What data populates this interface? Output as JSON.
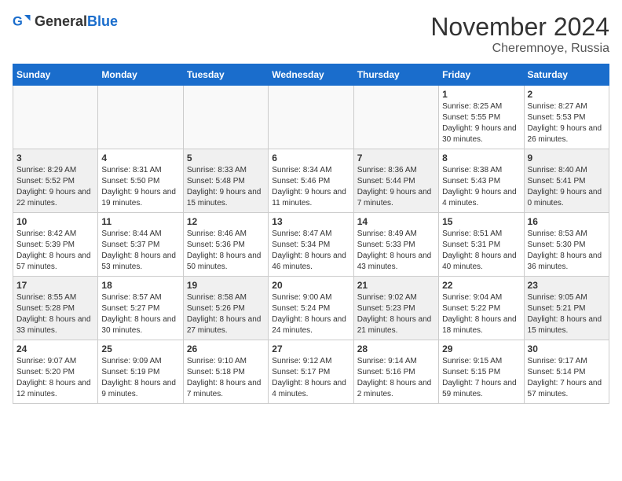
{
  "logo": {
    "general": "General",
    "blue": "Blue"
  },
  "header": {
    "month": "November 2024",
    "location": "Cheremnoye, Russia"
  },
  "weekdays": [
    "Sunday",
    "Monday",
    "Tuesday",
    "Wednesday",
    "Thursday",
    "Friday",
    "Saturday"
  ],
  "weeks": [
    [
      {
        "day": "",
        "info": ""
      },
      {
        "day": "",
        "info": ""
      },
      {
        "day": "",
        "info": ""
      },
      {
        "day": "",
        "info": ""
      },
      {
        "day": "",
        "info": ""
      },
      {
        "day": "1",
        "info": "Sunrise: 8:25 AM\nSunset: 5:55 PM\nDaylight: 9 hours and 30 minutes."
      },
      {
        "day": "2",
        "info": "Sunrise: 8:27 AM\nSunset: 5:53 PM\nDaylight: 9 hours and 26 minutes."
      }
    ],
    [
      {
        "day": "3",
        "info": "Sunrise: 8:29 AM\nSunset: 5:52 PM\nDaylight: 9 hours and 22 minutes."
      },
      {
        "day": "4",
        "info": "Sunrise: 8:31 AM\nSunset: 5:50 PM\nDaylight: 9 hours and 19 minutes."
      },
      {
        "day": "5",
        "info": "Sunrise: 8:33 AM\nSunset: 5:48 PM\nDaylight: 9 hours and 15 minutes."
      },
      {
        "day": "6",
        "info": "Sunrise: 8:34 AM\nSunset: 5:46 PM\nDaylight: 9 hours and 11 minutes."
      },
      {
        "day": "7",
        "info": "Sunrise: 8:36 AM\nSunset: 5:44 PM\nDaylight: 9 hours and 7 minutes."
      },
      {
        "day": "8",
        "info": "Sunrise: 8:38 AM\nSunset: 5:43 PM\nDaylight: 9 hours and 4 minutes."
      },
      {
        "day": "9",
        "info": "Sunrise: 8:40 AM\nSunset: 5:41 PM\nDaylight: 9 hours and 0 minutes."
      }
    ],
    [
      {
        "day": "10",
        "info": "Sunrise: 8:42 AM\nSunset: 5:39 PM\nDaylight: 8 hours and 57 minutes."
      },
      {
        "day": "11",
        "info": "Sunrise: 8:44 AM\nSunset: 5:37 PM\nDaylight: 8 hours and 53 minutes."
      },
      {
        "day": "12",
        "info": "Sunrise: 8:46 AM\nSunset: 5:36 PM\nDaylight: 8 hours and 50 minutes."
      },
      {
        "day": "13",
        "info": "Sunrise: 8:47 AM\nSunset: 5:34 PM\nDaylight: 8 hours and 46 minutes."
      },
      {
        "day": "14",
        "info": "Sunrise: 8:49 AM\nSunset: 5:33 PM\nDaylight: 8 hours and 43 minutes."
      },
      {
        "day": "15",
        "info": "Sunrise: 8:51 AM\nSunset: 5:31 PM\nDaylight: 8 hours and 40 minutes."
      },
      {
        "day": "16",
        "info": "Sunrise: 8:53 AM\nSunset: 5:30 PM\nDaylight: 8 hours and 36 minutes."
      }
    ],
    [
      {
        "day": "17",
        "info": "Sunrise: 8:55 AM\nSunset: 5:28 PM\nDaylight: 8 hours and 33 minutes."
      },
      {
        "day": "18",
        "info": "Sunrise: 8:57 AM\nSunset: 5:27 PM\nDaylight: 8 hours and 30 minutes."
      },
      {
        "day": "19",
        "info": "Sunrise: 8:58 AM\nSunset: 5:26 PM\nDaylight: 8 hours and 27 minutes."
      },
      {
        "day": "20",
        "info": "Sunrise: 9:00 AM\nSunset: 5:24 PM\nDaylight: 8 hours and 24 minutes."
      },
      {
        "day": "21",
        "info": "Sunrise: 9:02 AM\nSunset: 5:23 PM\nDaylight: 8 hours and 21 minutes."
      },
      {
        "day": "22",
        "info": "Sunrise: 9:04 AM\nSunset: 5:22 PM\nDaylight: 8 hours and 18 minutes."
      },
      {
        "day": "23",
        "info": "Sunrise: 9:05 AM\nSunset: 5:21 PM\nDaylight: 8 hours and 15 minutes."
      }
    ],
    [
      {
        "day": "24",
        "info": "Sunrise: 9:07 AM\nSunset: 5:20 PM\nDaylight: 8 hours and 12 minutes."
      },
      {
        "day": "25",
        "info": "Sunrise: 9:09 AM\nSunset: 5:19 PM\nDaylight: 8 hours and 9 minutes."
      },
      {
        "day": "26",
        "info": "Sunrise: 9:10 AM\nSunset: 5:18 PM\nDaylight: 8 hours and 7 minutes."
      },
      {
        "day": "27",
        "info": "Sunrise: 9:12 AM\nSunset: 5:17 PM\nDaylight: 8 hours and 4 minutes."
      },
      {
        "day": "28",
        "info": "Sunrise: 9:14 AM\nSunset: 5:16 PM\nDaylight: 8 hours and 2 minutes."
      },
      {
        "day": "29",
        "info": "Sunrise: 9:15 AM\nSunset: 5:15 PM\nDaylight: 7 hours and 59 minutes."
      },
      {
        "day": "30",
        "info": "Sunrise: 9:17 AM\nSunset: 5:14 PM\nDaylight: 7 hours and 57 minutes."
      }
    ]
  ]
}
